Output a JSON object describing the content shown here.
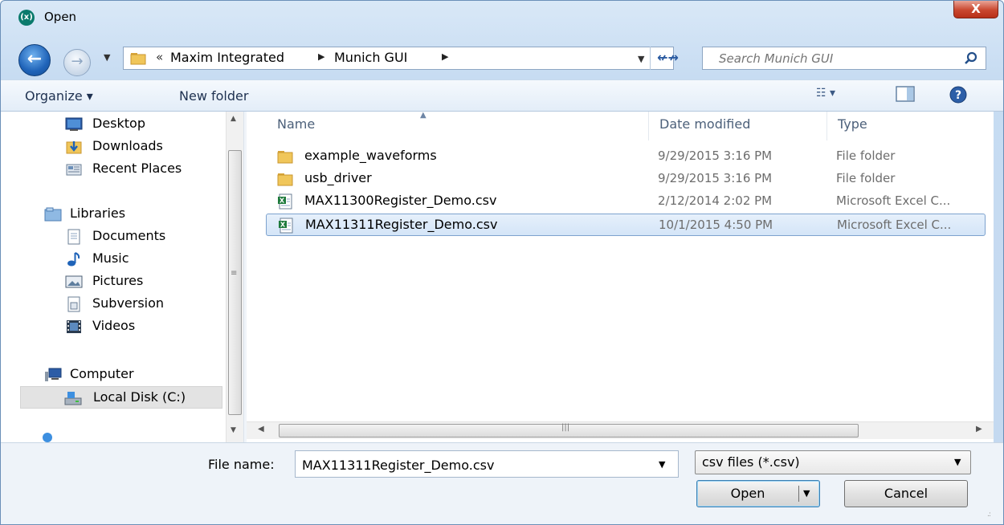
{
  "window": {
    "title": "Open",
    "logo_text": "(x)",
    "close_glyph": "X"
  },
  "address": {
    "overflow_glyph": "«",
    "crumbs": [
      "Maxim Integrated",
      "Munich GUI"
    ],
    "separator_glyph": "▶"
  },
  "search": {
    "placeholder": "Search Munich GUI"
  },
  "toolbar": {
    "organize_label": "Organize ▾",
    "new_folder_label": "New folder"
  },
  "nav": {
    "items": [
      {
        "label": "Desktop",
        "icon": "desktop-icon"
      },
      {
        "label": "Downloads",
        "icon": "downloads-icon"
      },
      {
        "label": "Recent Places",
        "icon": "recent-places-icon"
      },
      {
        "label": "Libraries",
        "icon": "libraries-icon"
      },
      {
        "label": "Documents",
        "icon": "documents-icon"
      },
      {
        "label": "Music",
        "icon": "music-icon"
      },
      {
        "label": "Pictures",
        "icon": "pictures-icon"
      },
      {
        "label": "Subversion",
        "icon": "subversion-icon"
      },
      {
        "label": "Videos",
        "icon": "videos-icon"
      },
      {
        "label": "Computer",
        "icon": "computer-icon"
      },
      {
        "label": "Local Disk (C:)",
        "icon": "local-disk-icon"
      }
    ]
  },
  "files": {
    "columns": {
      "name": "Name",
      "date": "Date modified",
      "type": "Type"
    },
    "rows": [
      {
        "name": "example_waveforms",
        "date": "9/29/2015 3:16 PM",
        "type": "File folder",
        "icon": "folder-icon"
      },
      {
        "name": "usb_driver",
        "date": "9/29/2015 3:16 PM",
        "type": "File folder",
        "icon": "folder-icon"
      },
      {
        "name": "MAX11300Register_Demo.csv",
        "date": "2/12/2014 2:02 PM",
        "type": "Microsoft Excel C...",
        "icon": "csv-file-icon"
      },
      {
        "name": "MAX11311Register_Demo.csv",
        "date": "10/1/2015 4:50 PM",
        "type": "Microsoft Excel C...",
        "icon": "csv-file-icon",
        "selected": true
      }
    ]
  },
  "footer": {
    "file_name_label": "File name:",
    "file_name_value": "MAX11311Register_Demo.csv",
    "filter_value": "csv files (*.csv)",
    "open_label": "Open",
    "cancel_label": "Cancel"
  },
  "colors": {
    "selection": "#d4e5f8",
    "selection_border": "#7da2ce",
    "close_button": "#c9472f",
    "folder": "#e8b84b"
  }
}
